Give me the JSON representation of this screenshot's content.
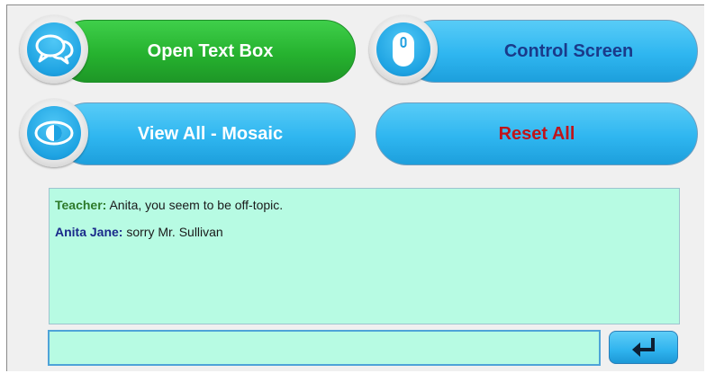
{
  "buttons": {
    "open_text_box": "Open Text Box",
    "control_screen": "Control Screen",
    "view_all_mosaic": "View All - Mosaic",
    "reset_all": "Reset All"
  },
  "chat": {
    "messages": [
      {
        "sender": "Teacher:",
        "text": " Anita, you seem to be off-topic."
      },
      {
        "sender": "Anita Jane:",
        "text": " sorry Mr. Sullivan"
      }
    ]
  },
  "input": {
    "value": "",
    "placeholder": ""
  },
  "icons": {
    "open_text_box": "chat-bubbles-icon",
    "control_screen": "mouse-icon",
    "view_all_mosaic": "eye-icon",
    "send": "enter-arrow-icon"
  },
  "colors": {
    "accent_green": "#26b22f",
    "accent_blue": "#2fb6f0",
    "chat_bg": "#b7fbe3",
    "reset_red": "#c0141a"
  }
}
